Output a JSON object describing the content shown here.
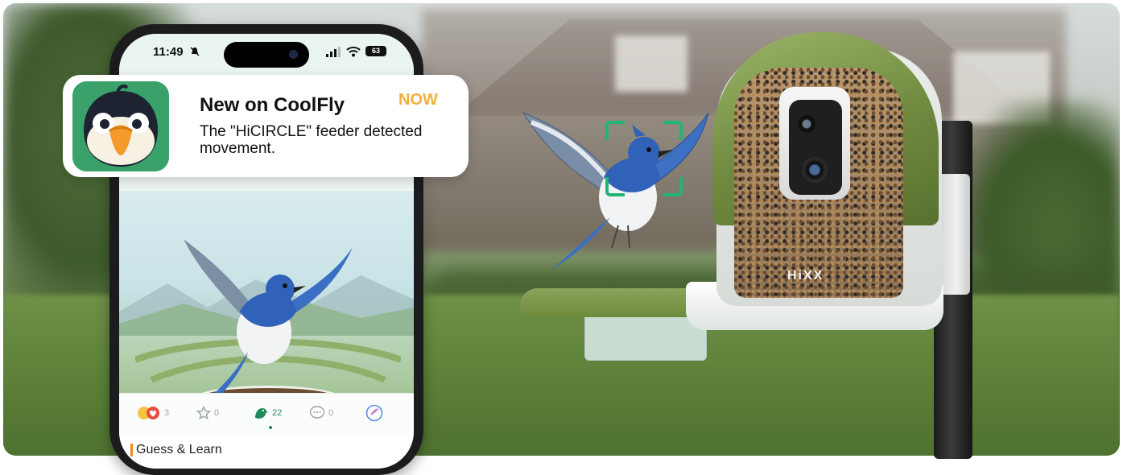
{
  "phone": {
    "status_time": "11:49",
    "battery": "63",
    "tabs": [
      {
        "label": "3",
        "icon": "reaction-icon"
      },
      {
        "label": "0",
        "icon": "star-icon"
      },
      {
        "label": "22",
        "icon": "bird-icon"
      },
      {
        "label": "0",
        "icon": "comment-icon"
      },
      {
        "label": "",
        "icon": "share-logo-icon"
      }
    ],
    "section_title": "Guess & Learn"
  },
  "notification": {
    "title": "New on CoolFly",
    "time": "NOW",
    "body": "The \"HiCIRCLE\" feeder detected movement."
  },
  "feeder": {
    "brand": "HiXX"
  },
  "colors": {
    "accent_green": "#21b573",
    "notif_time": "#f0b13a",
    "hood_green": "#6f8a3f"
  }
}
